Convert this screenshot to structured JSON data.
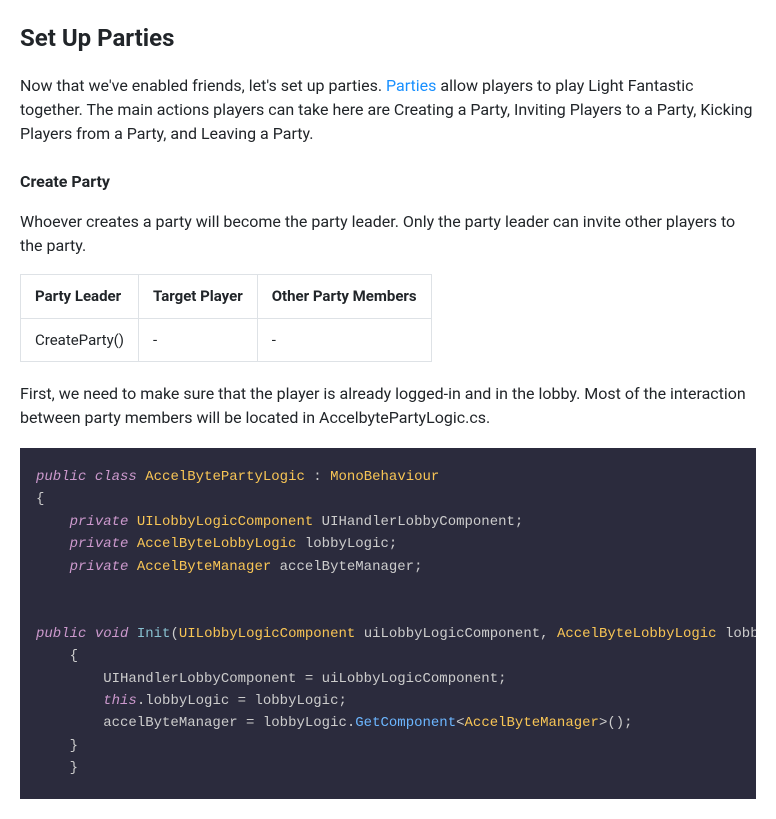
{
  "heading": "Set Up Parties",
  "intro": {
    "pre": "Now that we've enabled friends, let's set up parties. ",
    "link_text": "Parties",
    "post": " allow players to play Light Fantastic together. The main actions players can take here are Creating a Party, Inviting Players to a Party, Kicking Players from a Party, and Leaving a Party."
  },
  "create_heading": "Create Party",
  "create_desc": "Whoever creates a party will become the party leader. Only the party leader can invite other players to the party.",
  "table": {
    "headers": [
      "Party Leader",
      "Target Player",
      "Other Party Members"
    ],
    "rows": [
      [
        "CreateParty()",
        "-",
        "-"
      ]
    ]
  },
  "after_table": "First, we need to make sure that the player is already logged-in and in the lobby. Most of the interaction between party members will be located in AccelbytePartyLogic.cs.",
  "code": {
    "l1_public": "public",
    "l1_class": "class",
    "l1_type": "AccelBytePartyLogic",
    "l1_colon": ":",
    "l1_base": "MonoBehaviour",
    "l3_private": "private",
    "l3_type": "UILobbyLogicComponent",
    "l3_var": "UIHandlerLobbyComponent",
    "l4_private": "private",
    "l4_type": "AccelByteLobbyLogic",
    "l4_var": "lobbyLogic",
    "l5_private": "private",
    "l5_type": "AccelByteManager",
    "l5_var": "accelByteManager",
    "l7_public": "public",
    "l7_void": "void",
    "l7_fn": "Init",
    "l7_p1t": "UILobbyLogicComponent",
    "l7_p1n": "uiLobbyLogicComponent",
    "l7_p2t": "AccelByteLobbyLogic",
    "l7_p2n": "lobby",
    "l9_a": "UIHandlerLobbyComponent",
    "l9_b": "uiLobbyLogicComponent",
    "l10_this": "this",
    "l10_a": "lobbyLogic",
    "l10_b": "lobbyLogic",
    "l11_a": "accelByteManager",
    "l11_b": "lobbyLogic",
    "l11_fn": "GetComponent",
    "l11_g": "AccelByteManager"
  }
}
